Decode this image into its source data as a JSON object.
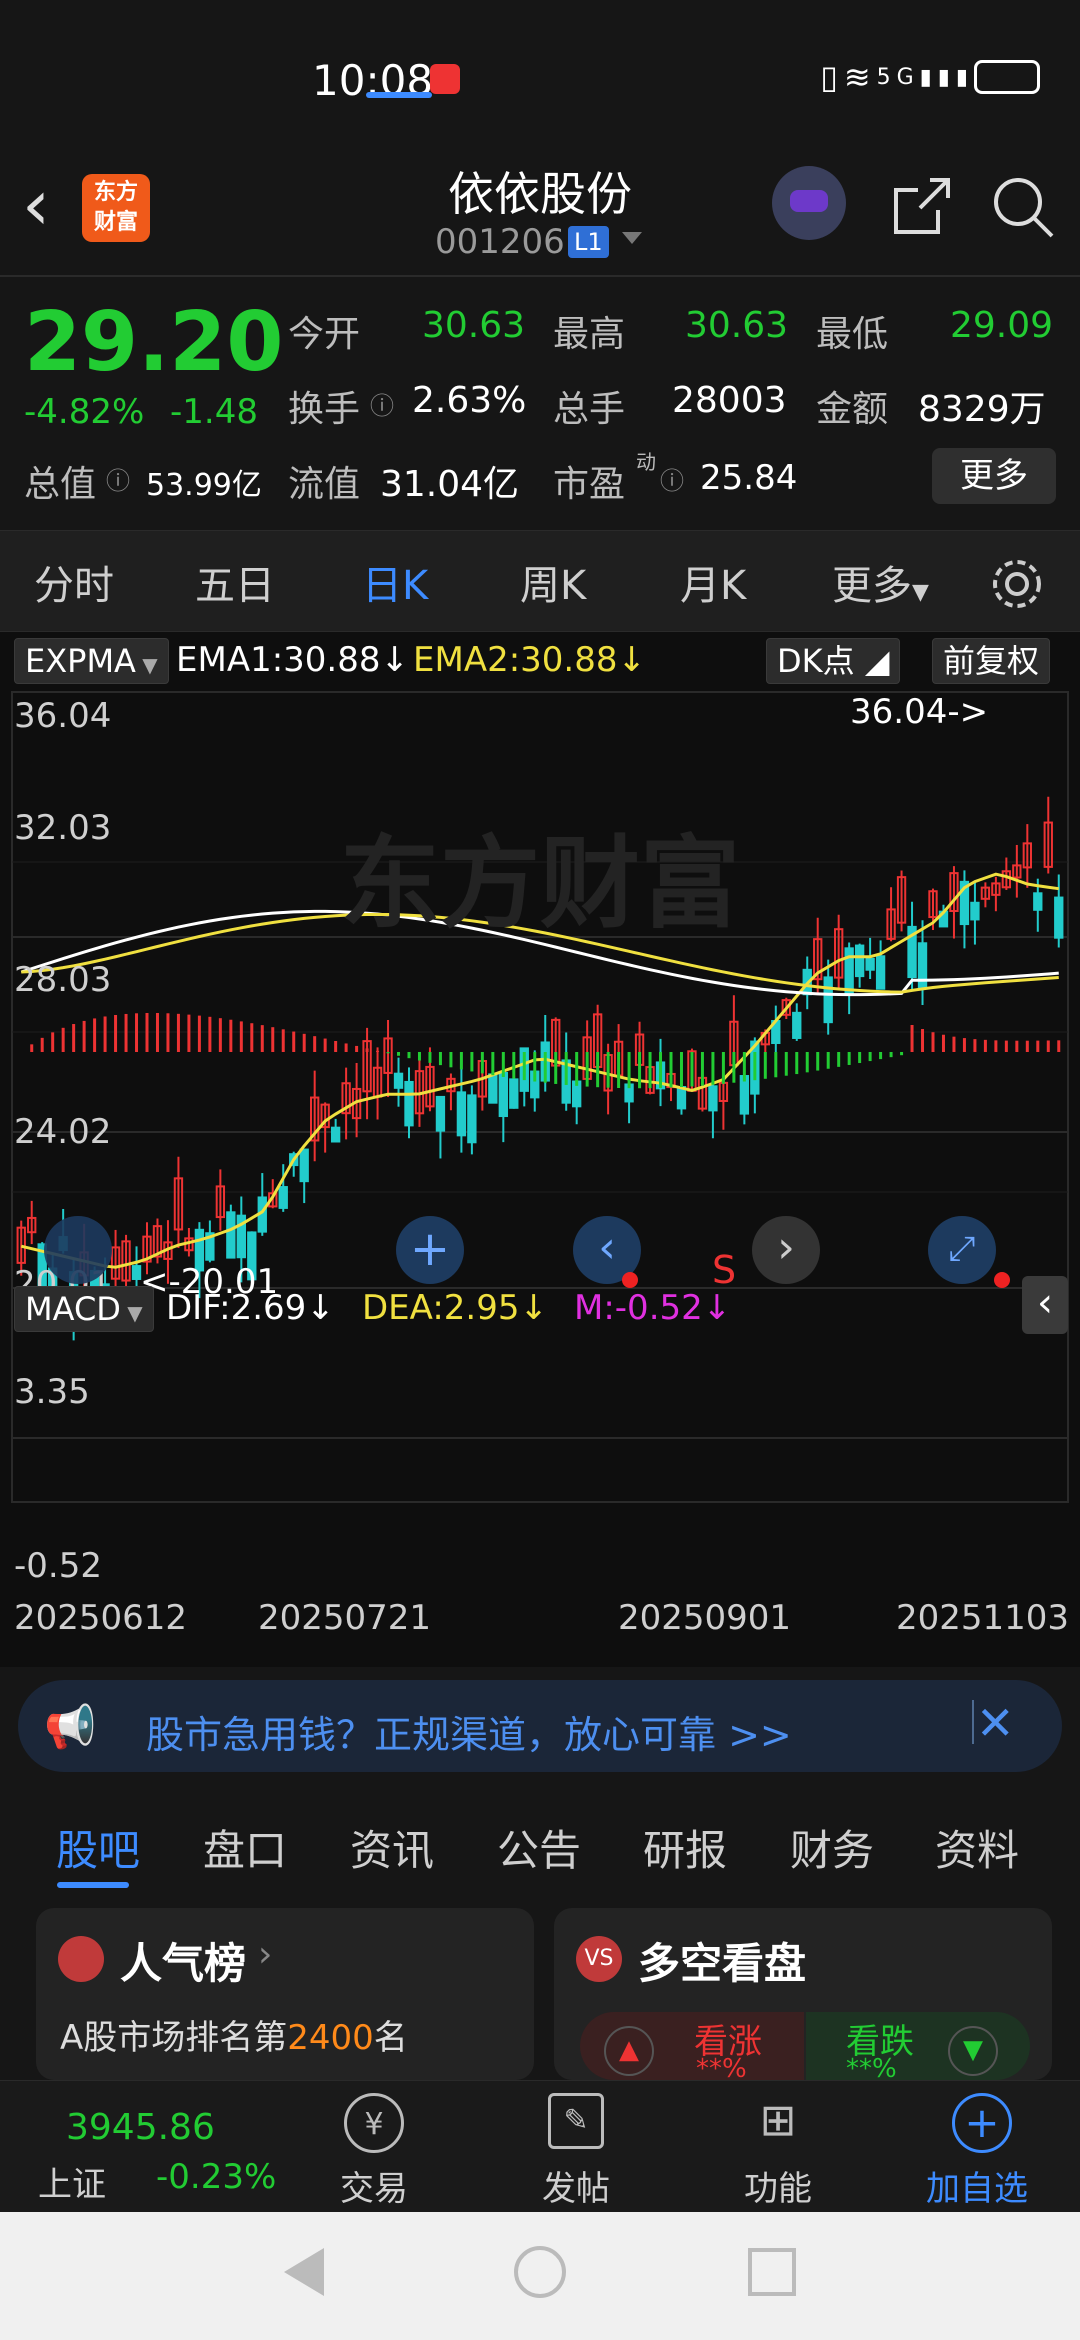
{
  "status": {
    "time": "10:08",
    "icons": "HD 5G"
  },
  "header": {
    "back_icon": "chevron-left-icon",
    "logo_text_1": "东方",
    "logo_text_2": "财富",
    "title": "依依股份",
    "code": "001206",
    "level": "L1"
  },
  "quote": {
    "price": "29.20",
    "pct": "-4.82%",
    "change": "-1.48",
    "open_label": "今开",
    "open": "30.63",
    "high_label": "最高",
    "high": "30.63",
    "low_label": "最低",
    "low": "29.09",
    "turnover_label": "换手",
    "turnover": "2.63%",
    "volume_label": "总手",
    "volume": "28003",
    "amount_label": "金额",
    "amount": "8329万",
    "mktcap_label": "总值",
    "mktcap": "53.99亿",
    "float_label": "流值",
    "float": "31.04亿",
    "pe_label": "市盈",
    "pe_sup": "动",
    "pe": "25.84",
    "more": "更多"
  },
  "tabs": [
    "分时",
    "五日",
    "日K",
    "周K",
    "月K",
    "更多"
  ],
  "chart_header": {
    "indicator": "EXPMA",
    "ema1": "EMA1:30.88↓",
    "ema2": "EMA2:30.88↓",
    "dk": "DK点",
    "adjust": "前复权",
    "watermark": "东方财富"
  },
  "colors": {
    "up": "#ee3333",
    "down": "#22cccc",
    "ema": "#f0e040",
    "dif": "#ffffff",
    "dea": "#f0e040",
    "macd_m": "#e030e0",
    "accent": "#3d8bff"
  },
  "chart_data": [
    {
      "type": "candlestick",
      "title": "",
      "y_ticks": [
        "36.04",
        "32.03",
        "28.03",
        "24.02",
        "20.01"
      ],
      "ylim": [
        20.01,
        36.04
      ],
      "max_label": "36.04->",
      "min_label": "<-20.01",
      "marker": "S",
      "ema_close_approx": [
        21.0,
        20.8,
        20.6,
        20.4,
        20.6,
        21.0,
        21.2,
        21.5,
        22.0,
        23.5,
        24.5,
        25.0,
        25.2,
        25.2,
        25.4,
        25.6,
        25.9,
        26.2,
        26.0,
        25.8,
        25.6,
        25.5,
        25.3,
        25.6,
        26.5,
        27.5,
        28.5,
        29.0,
        29.0,
        29.5,
        30.0,
        31.0,
        31.3,
        31.0,
        30.88
      ]
    },
    {
      "type": "line",
      "title": "",
      "indicator": "MACD",
      "dif": "DIF:2.69↓",
      "dea": "DEA:2.95↓",
      "m": "M:-0.52↓",
      "y_ticks": [
        "3.35",
        "-0.52"
      ],
      "x_ticks": [
        "20250612",
        "20250721",
        "20250901",
        "20251103"
      ]
    }
  ],
  "ad": {
    "text": "股市急用钱？正规渠道，放心可靠 >>"
  },
  "bottom_tabs": [
    "股吧",
    "盘口",
    "资讯",
    "公告",
    "研报",
    "财务",
    "资料"
  ],
  "cards": {
    "left_title": "人气榜",
    "left_line": "A股市场排名第",
    "left_rank": "2400",
    "left_suffix": "名",
    "right_title": "多空看盘",
    "up": "看涨",
    "down": "看跌",
    "up_pct": "**%",
    "down_pct": "**%"
  },
  "bottom_nav": {
    "index_value": "3945.86",
    "index_name": "上证",
    "index_change": "-0.23%",
    "items": [
      "交易",
      "发帖",
      "功能",
      "加自选"
    ]
  }
}
